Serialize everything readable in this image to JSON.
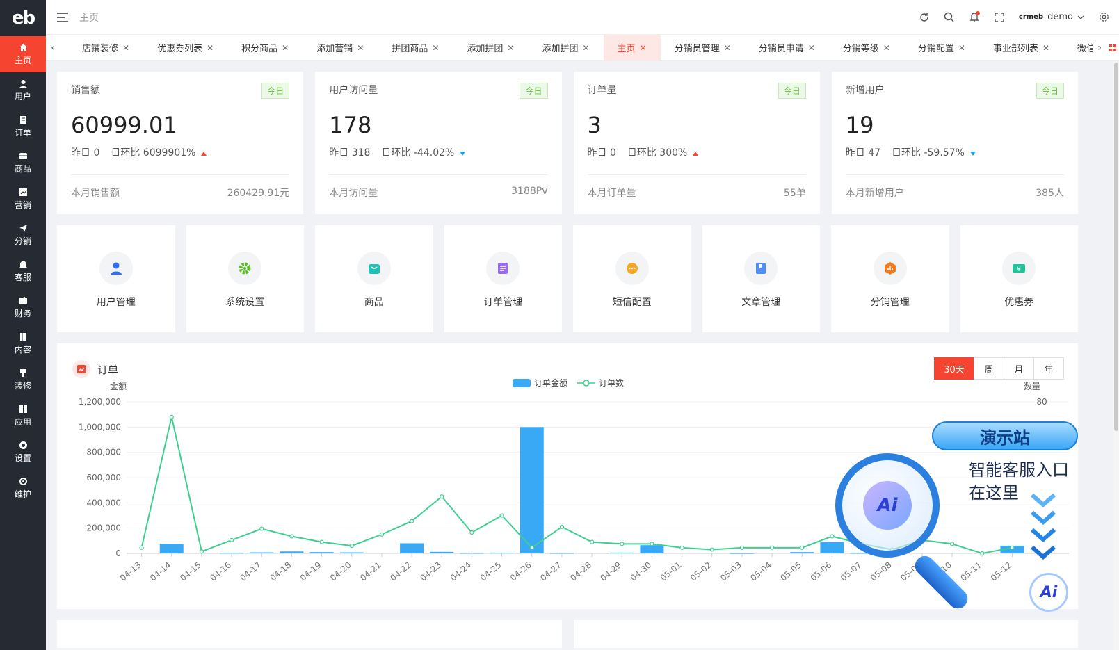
{
  "brand": {
    "logo_text": "eb",
    "accent": "#f5442f",
    "sidebar_bg": "#252a33"
  },
  "sidebar": {
    "items": [
      {
        "label": "主页",
        "icon": "home-icon",
        "active": true
      },
      {
        "label": "用户",
        "icon": "user-icon"
      },
      {
        "label": "订单",
        "icon": "order-icon"
      },
      {
        "label": "商品",
        "icon": "product-icon"
      },
      {
        "label": "营销",
        "icon": "marketing-icon"
      },
      {
        "label": "分销",
        "icon": "send-icon"
      },
      {
        "label": "客服",
        "icon": "bell-icon"
      },
      {
        "label": "财务",
        "icon": "wallet-icon"
      },
      {
        "label": "内容",
        "icon": "book-icon"
      },
      {
        "label": "装修",
        "icon": "brush-icon"
      },
      {
        "label": "应用",
        "icon": "apps-icon"
      },
      {
        "label": "设置",
        "icon": "gear-icon"
      },
      {
        "label": "维护",
        "icon": "maintenance-icon"
      }
    ]
  },
  "header": {
    "breadcrumb": "主页",
    "user": {
      "logo": "crmeb",
      "name": "demo"
    }
  },
  "tabs": [
    {
      "label": "店铺装修"
    },
    {
      "label": "优惠券列表"
    },
    {
      "label": "积分商品"
    },
    {
      "label": "添加营销"
    },
    {
      "label": "拼团商品"
    },
    {
      "label": "添加拼团"
    },
    {
      "label": "添加拼团"
    },
    {
      "label": "主页",
      "active": true
    },
    {
      "label": "分销员管理"
    },
    {
      "label": "分销员申请"
    },
    {
      "label": "分销等级"
    },
    {
      "label": "分销配置"
    },
    {
      "label": "事业部列表"
    },
    {
      "label": "微信菜"
    }
  ],
  "stats": [
    {
      "title": "销售额",
      "badge": "今日",
      "value": "60999.01",
      "yesterday": "昨日 0",
      "ratio": "日环比 6099901%",
      "trend": "up",
      "foot_label": "本月销售额",
      "foot_value": "260429.91元"
    },
    {
      "title": "用户访问量",
      "badge": "今日",
      "value": "178",
      "yesterday": "昨日 318",
      "ratio": "日环比 -44.02%",
      "trend": "down",
      "foot_label": "本月访问量",
      "foot_value": "3188Pv"
    },
    {
      "title": "订单量",
      "badge": "今日",
      "value": "3",
      "yesterday": "昨日 0",
      "ratio": "日环比 300%",
      "trend": "up",
      "foot_label": "本月订单量",
      "foot_value": "55单"
    },
    {
      "title": "新增用户",
      "badge": "今日",
      "value": "19",
      "yesterday": "昨日 47",
      "ratio": "日环比 -59.57%",
      "trend": "down",
      "foot_label": "本月新增用户",
      "foot_value": "385人"
    }
  ],
  "shortcuts": [
    {
      "label": "用户管理",
      "icon": "user-icon",
      "color": "#2f6ef5"
    },
    {
      "label": "系统设置",
      "icon": "gear-icon",
      "color": "#55c21b"
    },
    {
      "label": "商品",
      "icon": "bag-icon",
      "color": "#1fc2b5"
    },
    {
      "label": "订单管理",
      "icon": "list-icon",
      "color": "#9a6cf0"
    },
    {
      "label": "短信配置",
      "icon": "chat-icon",
      "color": "#f5a623"
    },
    {
      "label": "文章管理",
      "icon": "bookmark-icon",
      "color": "#4e8ef7"
    },
    {
      "label": "分销管理",
      "icon": "bar-chart-icon",
      "color": "#f37b1d"
    },
    {
      "label": "优惠券",
      "icon": "coupon-icon",
      "color": "#1ec497"
    }
  ],
  "order_chart": {
    "title": "订单",
    "ranges": [
      "30天",
      "周",
      "月",
      "年"
    ],
    "active_range": "30天"
  },
  "chart_data": {
    "type": "bar",
    "categories": [
      "04-13",
      "04-14",
      "04-15",
      "04-16",
      "04-17",
      "04-18",
      "04-19",
      "04-20",
      "04-21",
      "04-22",
      "04-23",
      "04-24",
      "04-25",
      "04-26",
      "04-27",
      "04-28",
      "04-29",
      "04-30",
      "05-01",
      "05-02",
      "05-03",
      "05-04",
      "05-05",
      "05-06",
      "05-07",
      "05-08",
      "05-09",
      "05-10",
      "05-11",
      "05-12"
    ],
    "series": [
      {
        "name": "订单金额",
        "type": "bar",
        "axis": "left",
        "color": "#3aa9f5",
        "values": [
          0,
          75000,
          0,
          4000,
          8000,
          15000,
          10000,
          8000,
          0,
          80000,
          12000,
          3000,
          5000,
          1000000,
          3000,
          0,
          6000,
          65000,
          0,
          0,
          2000,
          0,
          10000,
          90000,
          3000,
          15000,
          0,
          0,
          0,
          60999.01
        ]
      },
      {
        "name": "订单数",
        "type": "line",
        "axis": "right",
        "color": "#3ccf8e",
        "values": [
          3,
          72,
          1,
          7,
          13,
          9,
          6,
          4,
          10,
          17,
          30,
          11,
          20,
          3,
          14,
          6,
          5,
          5,
          3,
          2,
          3,
          3,
          3,
          9,
          5,
          2,
          7,
          5,
          0,
          3
        ]
      }
    ],
    "ylabel": "金额",
    "y2label": "数量",
    "ylim": [
      0,
      1200000
    ],
    "y2lim": [
      0,
      80
    ],
    "yticks": [
      "1,200,000",
      "1,000,000",
      "800,000",
      "600,000",
      "400,000",
      "200,000",
      "0"
    ],
    "y2ticks": [
      "80",
      "0"
    ],
    "legend": "top-center",
    "grid": true
  },
  "promo": {
    "pill": "演示站",
    "line1": "智能客服入口",
    "line2": "在这里",
    "ai": "Ai"
  }
}
